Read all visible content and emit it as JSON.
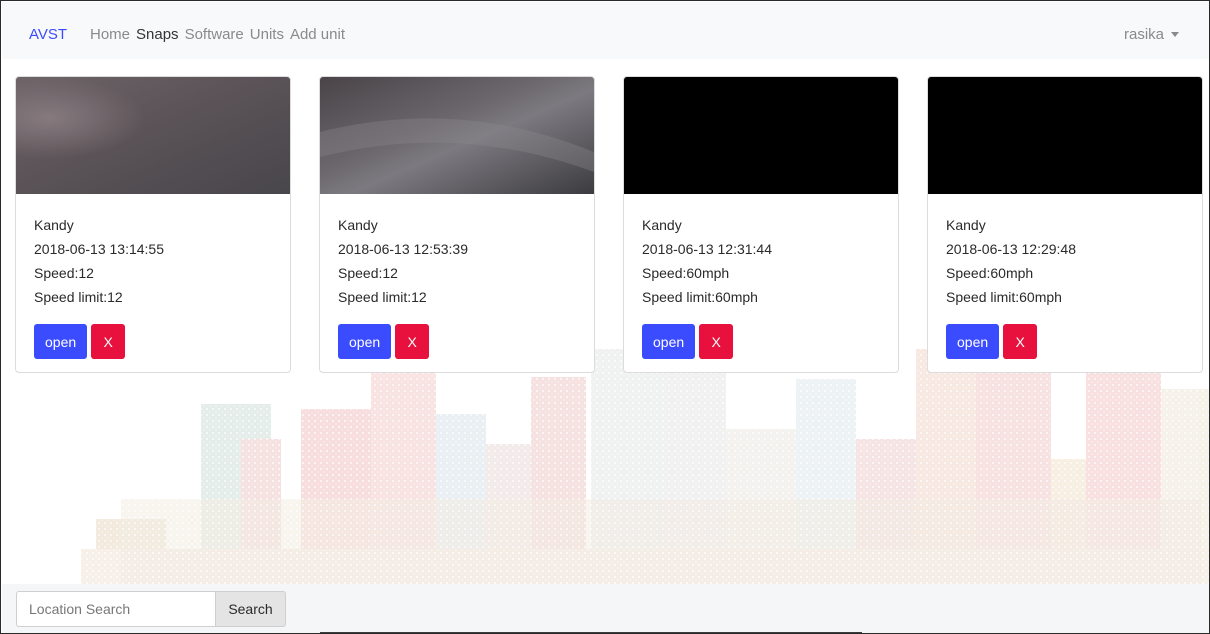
{
  "navbar": {
    "brand": "AVST",
    "links": [
      {
        "label": "Home",
        "active": false
      },
      {
        "label": "Snaps",
        "active": true
      },
      {
        "label": "Software",
        "active": false
      },
      {
        "label": "Units",
        "active": false
      },
      {
        "label": "Add unit",
        "active": false
      }
    ],
    "user": "rasika"
  },
  "cards": [
    {
      "location": "Kandy",
      "datetime": "2018-06-13 13:14:55",
      "speed": "Speed:12",
      "speed_limit": "Speed limit:12",
      "open_label": "open",
      "delete_label": "X",
      "image": "blurry-gray"
    },
    {
      "location": "Kandy",
      "datetime": "2018-06-13 12:53:39",
      "speed": "Speed:12",
      "speed_limit": "Speed limit:12",
      "open_label": "open",
      "delete_label": "X",
      "image": "blurry-streak"
    },
    {
      "location": "Kandy",
      "datetime": "2018-06-13 12:31:44",
      "speed": "Speed:60mph",
      "speed_limit": "Speed limit:60mph",
      "open_label": "open",
      "delete_label": "X",
      "image": "black"
    },
    {
      "location": "Kandy",
      "datetime": "2018-06-13 12:29:48",
      "speed": "Speed:60mph",
      "speed_limit": "Speed limit:60mph",
      "open_label": "open",
      "delete_label": "X",
      "image": "black"
    }
  ],
  "search": {
    "placeholder": "Location Search",
    "value": "",
    "button_label": "Search"
  },
  "colors": {
    "brand": "#3b4cff",
    "open_button": "#3b4cff",
    "delete_button": "#e8103c"
  }
}
